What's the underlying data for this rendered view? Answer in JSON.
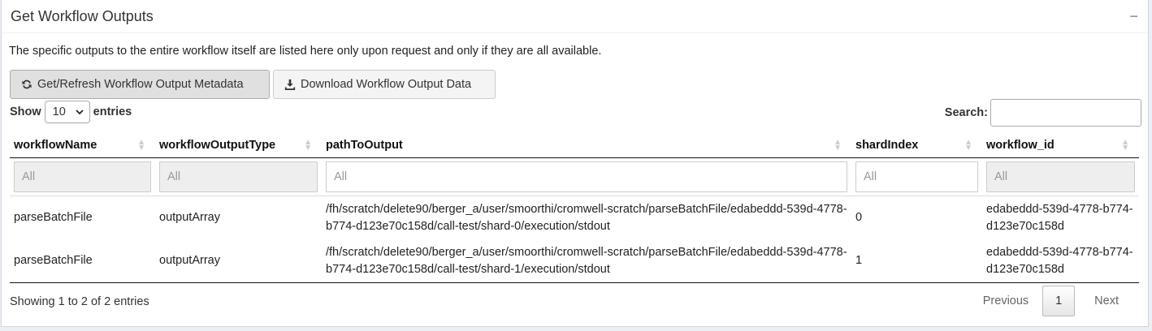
{
  "box": {
    "title": "Get Workflow Outputs",
    "collapse_symbol": "−"
  },
  "description": "The specific outputs to the entire workflow itself are listed here only upon request and only if they are all available.",
  "buttons": {
    "refresh_label": "Get/Refresh Workflow Output Metadata",
    "refresh_icon": "refresh-icon",
    "download_label": "Download Workflow Output Data",
    "download_icon": "download-icon"
  },
  "length": {
    "prefix": "Show",
    "value": "10",
    "suffix": "entries"
  },
  "search": {
    "label": "Search:",
    "value": ""
  },
  "table": {
    "columns": [
      "workflowName",
      "workflowOutputType",
      "pathToOutput",
      "shardIndex",
      "workflow_id"
    ],
    "filters": [
      "All",
      "All",
      "All",
      "All",
      "All"
    ],
    "rows": [
      {
        "workflowName": "parseBatchFile",
        "workflowOutputType": "outputArray",
        "pathToOutput": "/fh/scratch/delete90/berger_a/user/smoorthi/cromwell-scratch/parseBatchFile/edabeddd-539d-4778-b774-d123e70c158d/call-test/shard-0/execution/stdout",
        "shardIndex": "0",
        "workflow_id": "edabeddd-539d-4778-b774-d123e70c158d"
      },
      {
        "workflowName": "parseBatchFile",
        "workflowOutputType": "outputArray",
        "pathToOutput": "/fh/scratch/delete90/berger_a/user/smoorthi/cromwell-scratch/parseBatchFile/edabeddd-539d-4778-b774-d123e70c158d/call-test/shard-1/execution/stdout",
        "shardIndex": "1",
        "workflow_id": "edabeddd-539d-4778-b774-d123e70c158d"
      }
    ]
  },
  "footer": {
    "info": "Showing 1 to 2 of 2 entries",
    "previous": "Previous",
    "current_page": "1",
    "next": "Next"
  }
}
